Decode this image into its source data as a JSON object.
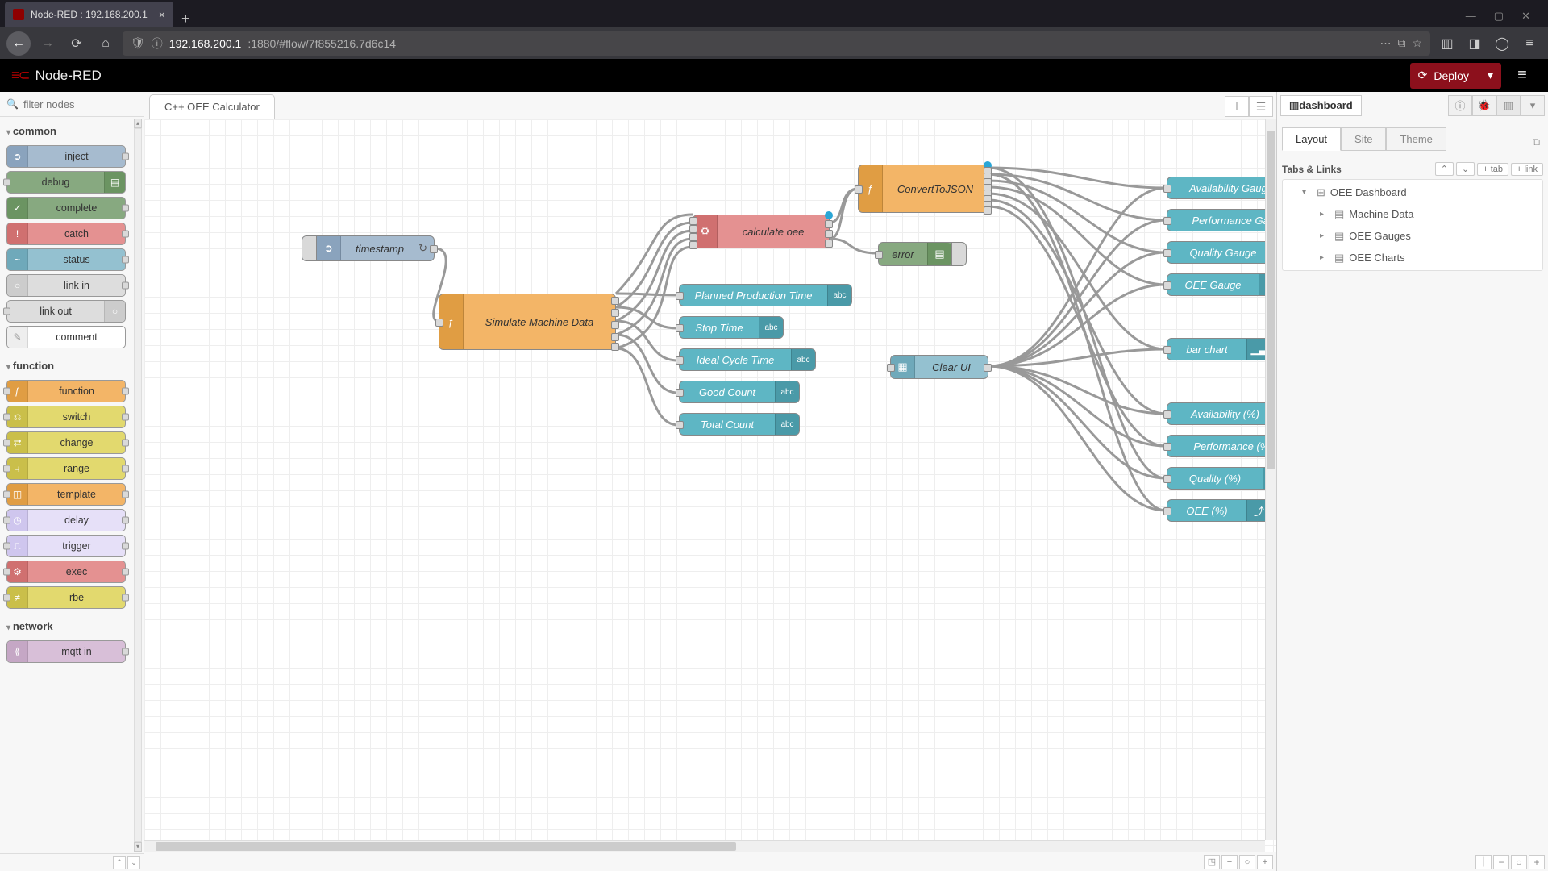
{
  "browser": {
    "tab_title": "Node-RED : 192.168.200.1",
    "url_host": "192.168.200.1",
    "url_path": ":1880/#flow/7f855216.7d6c14"
  },
  "header": {
    "brand": "Node-RED",
    "deploy": "Deploy"
  },
  "palette": {
    "filter_placeholder": "filter nodes",
    "cat_common": "common",
    "cat_function": "function",
    "cat_network": "network",
    "nodes": {
      "inject": "inject",
      "debug": "debug",
      "complete": "complete",
      "catch": "catch",
      "status": "status",
      "link_in": "link in",
      "link_out": "link out",
      "comment": "comment",
      "function": "function",
      "switch": "switch",
      "change": "change",
      "range": "range",
      "template": "template",
      "delay": "delay",
      "trigger": "trigger",
      "exec": "exec",
      "rbe": "rbe",
      "mqtt_in": "mqtt in"
    }
  },
  "flow": {
    "tab": "C++ OEE Calculator",
    "nodes": {
      "timestamp": "timestamp",
      "simulate": "Simulate Machine Data",
      "calc": "calculate oee",
      "convert": "ConvertToJSON",
      "error": "error",
      "clear": "Clear UI",
      "ppt": "Planned Production Time",
      "stop": "Stop Time",
      "ict": "Ideal Cycle Time",
      "good": "Good Count",
      "total": "Total Count",
      "g_avail": "Availability Gauge",
      "g_perf": "Performance Gauge",
      "g_qual": "Quality Gauge",
      "g_oee": "OEE Gauge",
      "bar": "bar chart",
      "c_avail": "Availability (%)",
      "c_perf": "Performance (%)",
      "c_qual": "Quality (%)",
      "c_oee": "OEE (%)"
    }
  },
  "sidebar": {
    "tab": "dashboard",
    "sub_layout": "Layout",
    "sub_site": "Site",
    "sub_theme": "Theme",
    "hdr": "Tabs & Links",
    "btn_tab": "tab",
    "btn_link": "link",
    "tree": {
      "root": "OEE Dashboard",
      "g1": "Machine Data",
      "g2": "OEE Gauges",
      "g3": "OEE Charts"
    }
  }
}
